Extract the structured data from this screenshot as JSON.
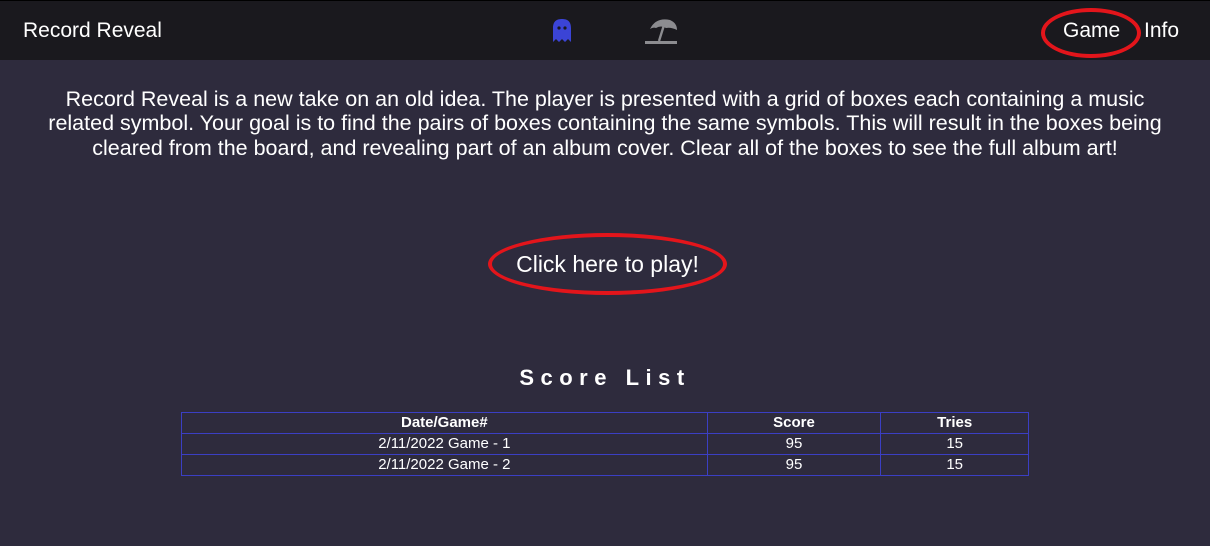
{
  "header": {
    "brand": "Record Reveal",
    "nav": {
      "game": "Game",
      "info": "Info"
    },
    "icons": {
      "ghost": "ghost-icon",
      "beach": "beach-umbrella-icon"
    },
    "colors": {
      "ghost": "#3b44d6",
      "beach": "#8c8c90"
    }
  },
  "main": {
    "intro": "Record Reveal is a new take on an old idea. The player is presented with a grid of boxes each containing a music related symbol. Your goal is to find the pairs of boxes containing the same symbols. This will result in the boxes being cleared from the board, and revealing part of an album cover. Clear all of the boxes to see the full album art!",
    "play_link": "Click here to play!"
  },
  "scores": {
    "title": "Score List",
    "columns": [
      "Date/Game#",
      "Score",
      "Tries"
    ],
    "rows": [
      [
        "2/11/2022 Game - 1",
        "95",
        "15"
      ],
      [
        "2/11/2022 Game - 2",
        "95",
        "15"
      ]
    ]
  },
  "colors": {
    "background": "#2e2b3d",
    "topbar": "#1a191e",
    "table_border": "#3b3fc4",
    "annotation": "#e3151b"
  }
}
